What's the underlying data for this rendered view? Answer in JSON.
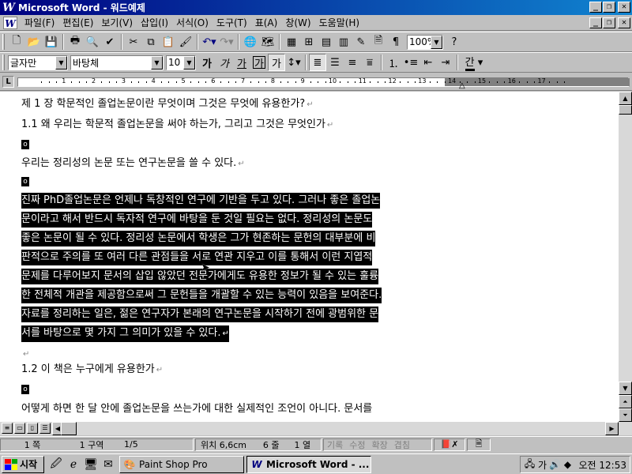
{
  "window": {
    "title": "Microsoft Word - 워드예제",
    "app_icon": "W"
  },
  "menu": [
    "파일(F)",
    "편집(E)",
    "보기(V)",
    "삽입(I)",
    "서식(O)",
    "도구(T)",
    "표(A)",
    "창(W)",
    "도움말(H)"
  ],
  "toolbar": {
    "zoom": "100%"
  },
  "format": {
    "style": "글자만",
    "font": "바탕체",
    "size": "10",
    "buttons": [
      "가",
      "가",
      "가",
      "가",
      "가"
    ],
    "color_label": "간"
  },
  "ruler": {
    "numbers": [
      "1",
      "2",
      "3",
      "4",
      "5",
      "6",
      "7",
      "8",
      "9",
      "10",
      "11",
      "12",
      "13",
      "14",
      "15",
      "16",
      "17"
    ]
  },
  "document": {
    "paragraphs": [
      "제 1 장 학문적인 졸업논문이란 무엇이며 그것은 무엇에 유용한가?",
      "1.1 왜 우리는 학문적 졸업논문을 써야 하는가, 그리고 그것은 무엇인가",
      "우리는 정리성의 논문 또는 연구논문을 쓸 수 있다.",
      "진짜 PhD졸업논문은 언제나 독창적인 연구에 기반을 두고 있다. 그러나 좋은 졸업논",
      "문이라고 해서 반드시 독자적 연구에 바탕을 둔 것일 필요는 없다. 정리성의 논문도",
      "좋은 논문이 될 수 있다. 정리성 논문에서 학생은 그가 현존하는 문헌의 대부분에 비",
      "판적으로 주의를  또 여러 다른 관점들을 서로 연관 지우고 이를 통해서 이런 지엽적",
      "문제를 다루어보지 문서의 삽입 않았던 전문가에게도 유용한 정보가 될 수 있는 훌륭",
      "한 전체적 개관을 제공함으로써 그 문헌들을 개괄할 수 있는 능력이 있음을 보여준다.",
      "자료를 정리하는 일은, 젊은 연구자가 본래의 연구논문을 시작하기 전에 광범위한 문",
      "서를 바탕으로 몇 가지 그 의미가 있을 수 있다.",
      "1.2 이 책은 누구에게 유용한가",
      "어떻게 하면 한 달 안에 졸업논문을 쓰는가에 대한 실제적인 조언이 아니다. 문서를"
    ],
    "bullet_char": "o",
    "para_mark": "↵"
  },
  "statusbar": {
    "page": "1 쪽",
    "section": "1 구역",
    "pages": "1/5",
    "position": "위치 6,6cm",
    "line": "6 줄",
    "column": "1 열",
    "modes": [
      "기록",
      "수정",
      "확장",
      "겹침"
    ]
  },
  "taskbar": {
    "start": "시작",
    "items": [
      "Paint Shop Pro",
      "Microsoft Word - ..."
    ],
    "clock": "오전 12:53"
  }
}
